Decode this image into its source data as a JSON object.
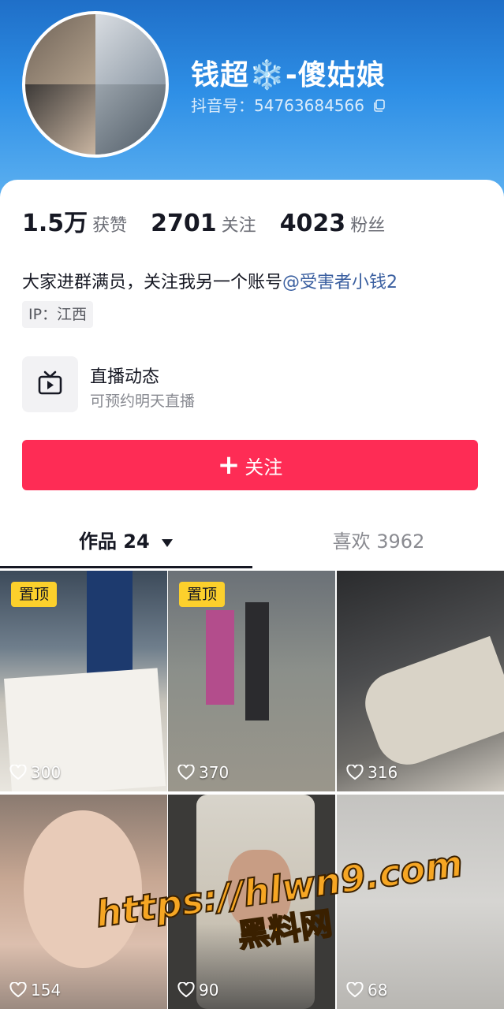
{
  "profile": {
    "name": "钱超❄️-傻姑娘",
    "douyin_id": "抖音号：54763684566",
    "stats": [
      {
        "num": "1.5万",
        "label": "获赞"
      },
      {
        "num": "2701",
        "label": "关注"
      },
      {
        "num": "4023",
        "label": "粉丝"
      }
    ],
    "bio_text": "大家进群满员，关注我另一个账号",
    "bio_mention": "@受害者小钱2",
    "ip": "IP：江西"
  },
  "live": {
    "title": "直播动态",
    "subtitle": "可预约明天直播"
  },
  "follow_button": {
    "icon": "+",
    "label": "关注"
  },
  "tabs": {
    "works": "作品 24",
    "likes": "喜欢 3962"
  },
  "videos": [
    {
      "pinned": "置顶",
      "likes": "300"
    },
    {
      "pinned": "置顶",
      "likes": "370"
    },
    {
      "likes": "316"
    },
    {
      "likes": "154"
    },
    {
      "likes": "90"
    },
    {
      "likes": "68"
    }
  ],
  "watermark": {
    "url": "https://hlwn9.com",
    "label": "黑料网"
  },
  "colors": {
    "header_blue": "#2e8fe6",
    "follow_red": "#fe2c55",
    "pin_yellow": "#fcd02c",
    "mention_blue": "#3a5fa0"
  }
}
